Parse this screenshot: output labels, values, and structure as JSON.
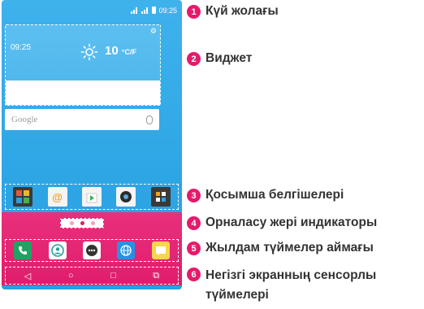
{
  "phone": {
    "status_time": "09:25",
    "widget": {
      "clock": "09:25",
      "temperature": "10",
      "unit": "°C/F"
    },
    "search": {
      "placeholder": "Google"
    },
    "apps": [
      {
        "name": "gallery",
        "color": "#3a3a3a"
      },
      {
        "name": "email",
        "color": "#f4f4f4"
      },
      {
        "name": "play-store",
        "color": "#f4f4f4"
      },
      {
        "name": "camera",
        "color": "#f4f4f4"
      },
      {
        "name": "apps-folder",
        "color": "#3a3a3a"
      }
    ],
    "page_indicator": {
      "count": 3,
      "active_index": 1
    },
    "quick_keys": [
      {
        "name": "phone",
        "color": "#1fa362"
      },
      {
        "name": "contacts",
        "color": "#ffffff"
      },
      {
        "name": "apps",
        "color": "#ffffff"
      },
      {
        "name": "browser",
        "color": "#2592e4"
      },
      {
        "name": "messaging",
        "color": "#f7d64a"
      }
    ],
    "nav_glyphs": {
      "back": "◁",
      "home": "○",
      "recent": "□",
      "dual": "⧉"
    }
  },
  "callouts": [
    {
      "number": "1",
      "text": "Күй жолағы"
    },
    {
      "number": "2",
      "text": "Виджет"
    },
    {
      "number": "3",
      "text": "Қосымша белгішелері"
    },
    {
      "number": "4",
      "text": "Орналасу жері индикаторы"
    },
    {
      "number": "5",
      "text": "Жылдам түймелер аймағы"
    },
    {
      "number": "6",
      "text": "Негізгі экранның сенсорлы түймелері"
    }
  ],
  "colors": {
    "accent": "#e61a6b",
    "screen": "#33a9e7"
  }
}
